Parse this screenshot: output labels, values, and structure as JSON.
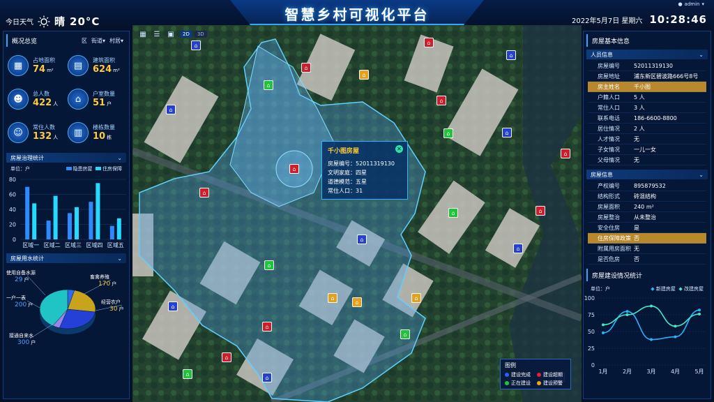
{
  "header": {
    "title": "智慧乡村可视化平台",
    "weather_label": "今日天气",
    "weather": "晴",
    "temperature": "20°C",
    "date": "2022年5月7日 星期六",
    "time": "10:28:46",
    "user": "admin"
  },
  "overview": {
    "title": "概况总览",
    "tabs": [
      "区",
      "街道",
      "村居"
    ],
    "stats": [
      {
        "label": "占地面积",
        "value": "74",
        "unit": "m²",
        "icon": "building-icon"
      },
      {
        "label": "建筑面积",
        "value": "624",
        "unit": "m²",
        "icon": "blueprint-icon"
      },
      {
        "label": "总人数",
        "value": "422",
        "unit": "人",
        "icon": "person-icon"
      },
      {
        "label": "户室数量",
        "value": "51",
        "unit": "户",
        "icon": "house-icon"
      },
      {
        "label": "常住人数",
        "value": "132",
        "unit": "人",
        "icon": "people-icon"
      },
      {
        "label": "楼栋数量",
        "value": "10",
        "unit": "栋",
        "icon": "tower-icon"
      }
    ]
  },
  "housing_gov": {
    "title": "房屋治理统计",
    "unit": "单位：户",
    "legend": [
      "隐患房屋",
      "住房保障"
    ]
  },
  "water": {
    "title": "房屋用水统计",
    "slices": [
      {
        "label": "使用自备水源",
        "value": "29",
        "unit": "户"
      },
      {
        "label": "畜禽养殖",
        "value": "170",
        "unit": "户"
      },
      {
        "label": "一户一表",
        "value": "200",
        "unit": "户"
      },
      {
        "label": "经营农户",
        "value": "30",
        "unit": "户"
      },
      {
        "label": "接通自来水",
        "value": "300",
        "unit": "户"
      }
    ]
  },
  "map": {
    "toggle_2d": "2D",
    "toggle_3d": "3D",
    "popup": {
      "title": "千小图房屋",
      "rows": [
        "房屋编号：52011319130",
        "文明家庭：四星",
        "道德模范：五星",
        "常住人口：31"
      ]
    },
    "legend_title": "图例",
    "legend": [
      "建设完成",
      "建设超期",
      "正在建设",
      "建设预警"
    ]
  },
  "house_info": {
    "title": "房屋基本信息",
    "person_section": "人员信息",
    "person_rows": [
      {
        "k": "房屋编号",
        "v": "52011319130"
      },
      {
        "k": "房屋地址",
        "v": "浦东新区碧波路666号8号"
      },
      {
        "k": "房主姓名",
        "v": "千小图"
      },
      {
        "k": "户籍人口",
        "v": "5 人"
      },
      {
        "k": "常住人口",
        "v": "3 人"
      },
      {
        "k": "联系电话",
        "v": "186-6600-8800"
      },
      {
        "k": "居住情况",
        "v": "2 人"
      },
      {
        "k": "人才情况",
        "v": "无"
      },
      {
        "k": "子女情况",
        "v": "一儿一女"
      },
      {
        "k": "父母情况",
        "v": "无"
      }
    ],
    "house_section": "房屋信息",
    "house_rows": [
      {
        "k": "产权编号",
        "v": "895879532"
      },
      {
        "k": "结构形式",
        "v": "砖混结构"
      },
      {
        "k": "房屋面积",
        "v": "240 m²"
      },
      {
        "k": "房屋整治",
        "v": "从未整治"
      },
      {
        "k": "安全住房",
        "v": "是"
      },
      {
        "k": "住房保障政策",
        "v": "否"
      },
      {
        "k": "附属用房面积",
        "v": "无"
      },
      {
        "k": "是否危房",
        "v": "否"
      }
    ]
  },
  "build_stats": {
    "title": "房屋建设情况统计",
    "unit": "单位：户"
  },
  "chart_data": [
    {
      "type": "bar",
      "title": "房屋治理统计",
      "categories": [
        "区域一",
        "区域二",
        "区域三",
        "区域四",
        "区域五"
      ],
      "series": [
        {
          "name": "隐患房屋",
          "values": [
            70,
            25,
            35,
            50,
            18
          ]
        },
        {
          "name": "住房保障",
          "values": [
            48,
            58,
            43,
            75,
            28
          ]
        }
      ],
      "ylim": [
        0,
        80
      ],
      "yticks": [
        0,
        20,
        40,
        60,
        80
      ],
      "colors": [
        "#2e8bff",
        "#25d9ff"
      ]
    },
    {
      "type": "pie",
      "title": "房屋用水统计",
      "labels": [
        "使用自备水源",
        "畜禽养殖",
        "一户一表",
        "经营农户",
        "接通自来水"
      ],
      "values": [
        29,
        170,
        200,
        30,
        300
      ],
      "colors": [
        "#2b6cf0",
        "#c8a41c",
        "#2440d6",
        "#9a86e8",
        "#20c4c4"
      ]
    },
    {
      "type": "line",
      "title": "房屋建设情况统计",
      "categories": [
        "1月",
        "2月",
        "3月",
        "4月",
        "5月"
      ],
      "series": [
        {
          "name": "新建房屋",
          "values": [
            48,
            80,
            38,
            42,
            82
          ]
        },
        {
          "name": "改建房屋",
          "values": [
            60,
            75,
            88,
            58,
            76
          ]
        }
      ],
      "ylim": [
        0,
        100
      ],
      "yticks": [
        0,
        25,
        50,
        75,
        100
      ],
      "colors": [
        "#28b4ff",
        "#44e8c6"
      ]
    }
  ]
}
